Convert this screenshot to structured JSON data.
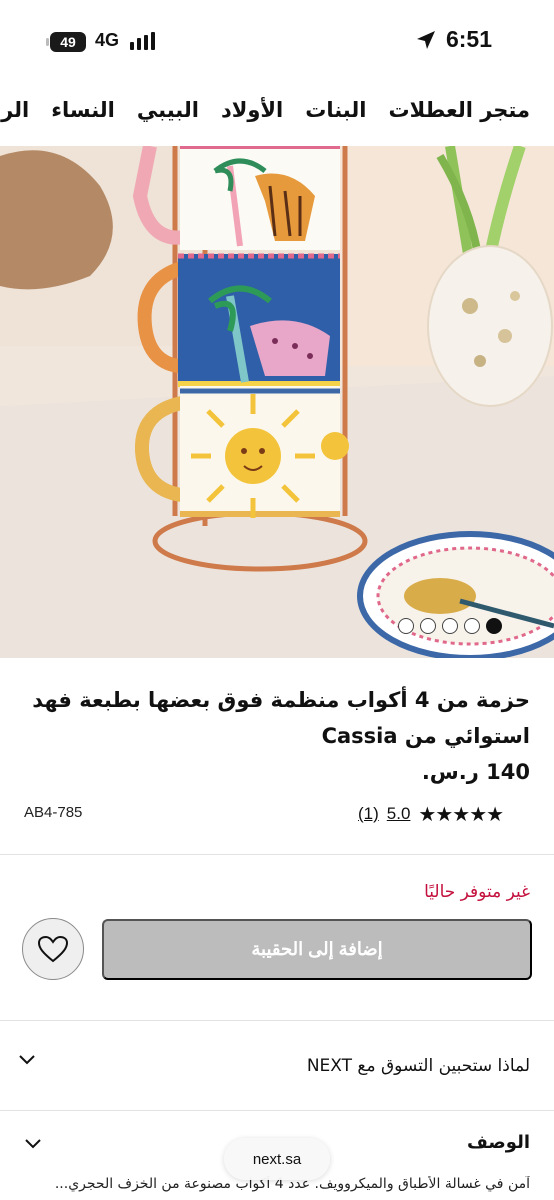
{
  "status_bar": {
    "time": "6:51",
    "network": "4G",
    "battery": "49"
  },
  "category_nav": {
    "items": [
      "متجر العطلات",
      "البنات",
      "الأولاد",
      "البيبي",
      "النساء",
      "الرجال"
    ]
  },
  "carousel": {
    "total": 5,
    "active_index": 0
  },
  "product": {
    "title": "حزمة من 4 أكواب منظمة فوق بعضها بطبعة فهد استوائي من Cassia",
    "price": "140 ر.س.",
    "rating_score": "5.0",
    "rating_count": "(1)",
    "stars": "★★★★★",
    "sku": "AB4-785"
  },
  "availability": {
    "status": "غير متوفر حاليًا",
    "add_to_bag": "إضافة إلى الحقيبة"
  },
  "why_shop": {
    "label": "لماذا ستحبين التسوق مع NEXT"
  },
  "description": {
    "title": "الوصف",
    "text": "آمن في غسالة الأطباق والميكروويف. عدد 4 أكواب مصنوعة من الخزف الحجري..."
  },
  "browser": {
    "url": "next.sa"
  },
  "colors": {
    "stock_red": "#c4103d",
    "button_disabled": "#bcbcbc"
  }
}
